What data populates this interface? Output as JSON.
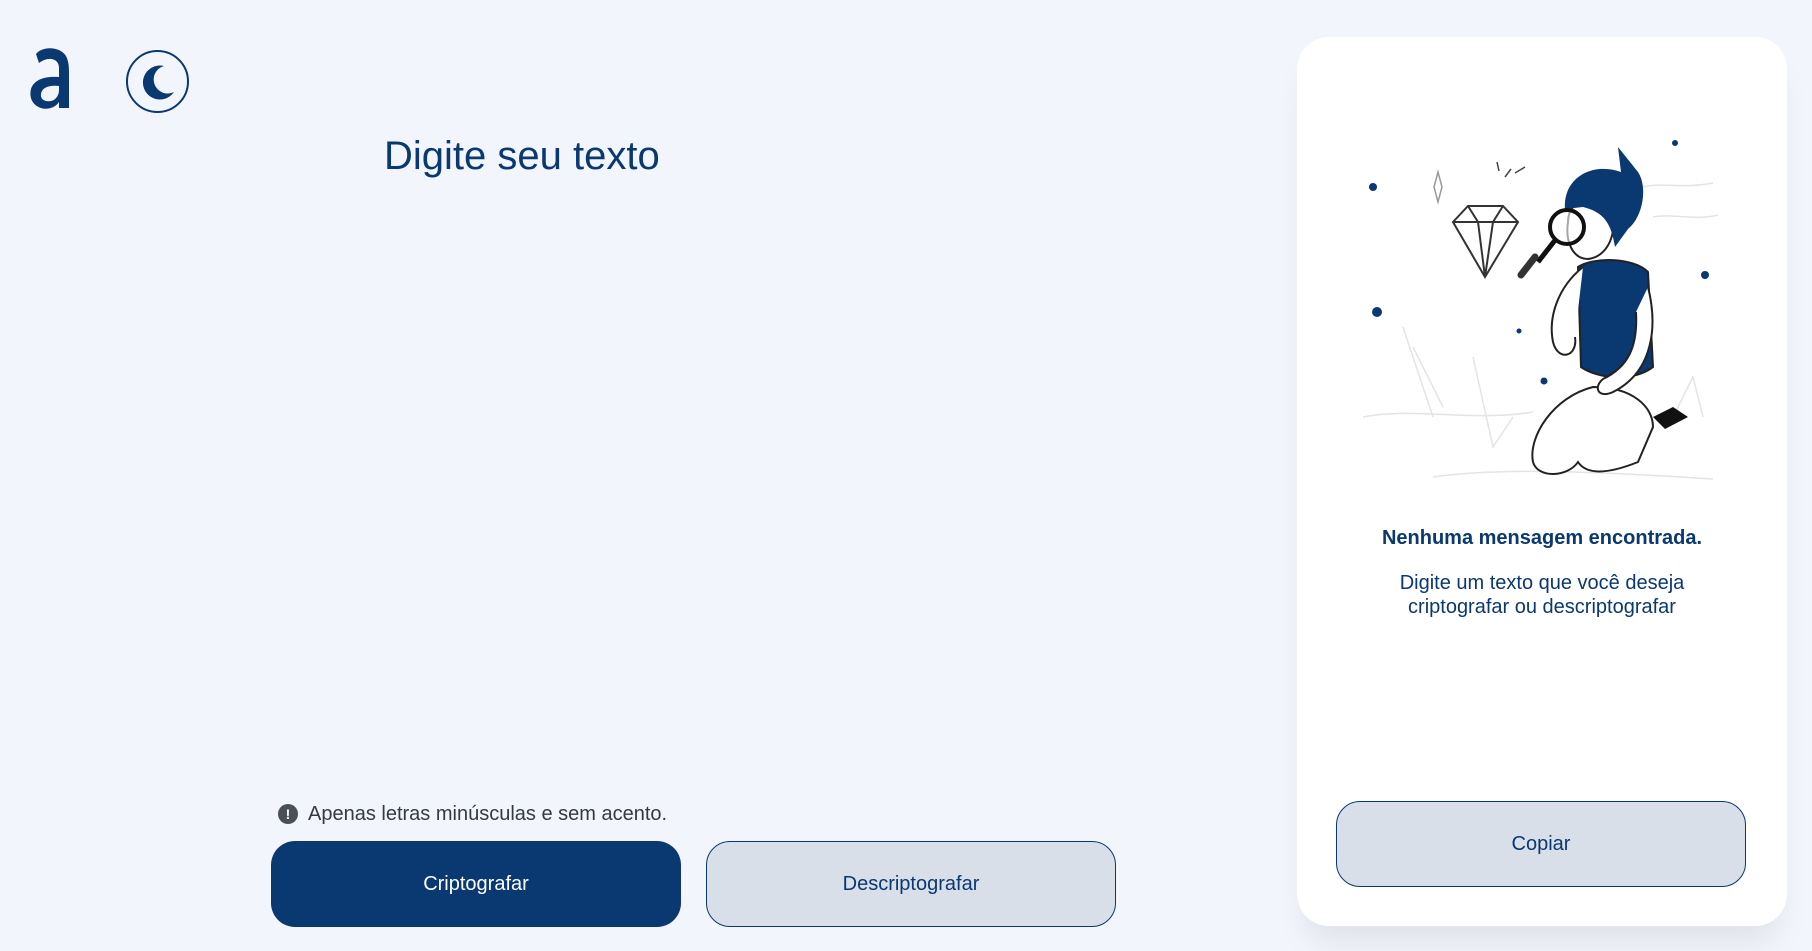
{
  "theme": {
    "accent": "#0a3871",
    "background": "#f3f5fc",
    "panel": "#ffffff"
  },
  "header": {
    "logo_icon": "alura-logo-icon",
    "theme_toggle_icon": "moon-icon"
  },
  "input": {
    "placeholder": "Digite seu texto",
    "value": ""
  },
  "warning": {
    "icon": "exclamation-circle-icon",
    "text": "Apenas letras minúsculas e sem acento."
  },
  "buttons": {
    "encrypt": "Criptografar",
    "decrypt": "Descriptografar"
  },
  "output": {
    "illustration": "boy-with-magnifying-glass-illustration",
    "empty_title": "Nenhuma mensagem encontrada.",
    "empty_description": "Digite um texto que você deseja criptografar ou descriptografar",
    "copy_label": "Copiar"
  }
}
